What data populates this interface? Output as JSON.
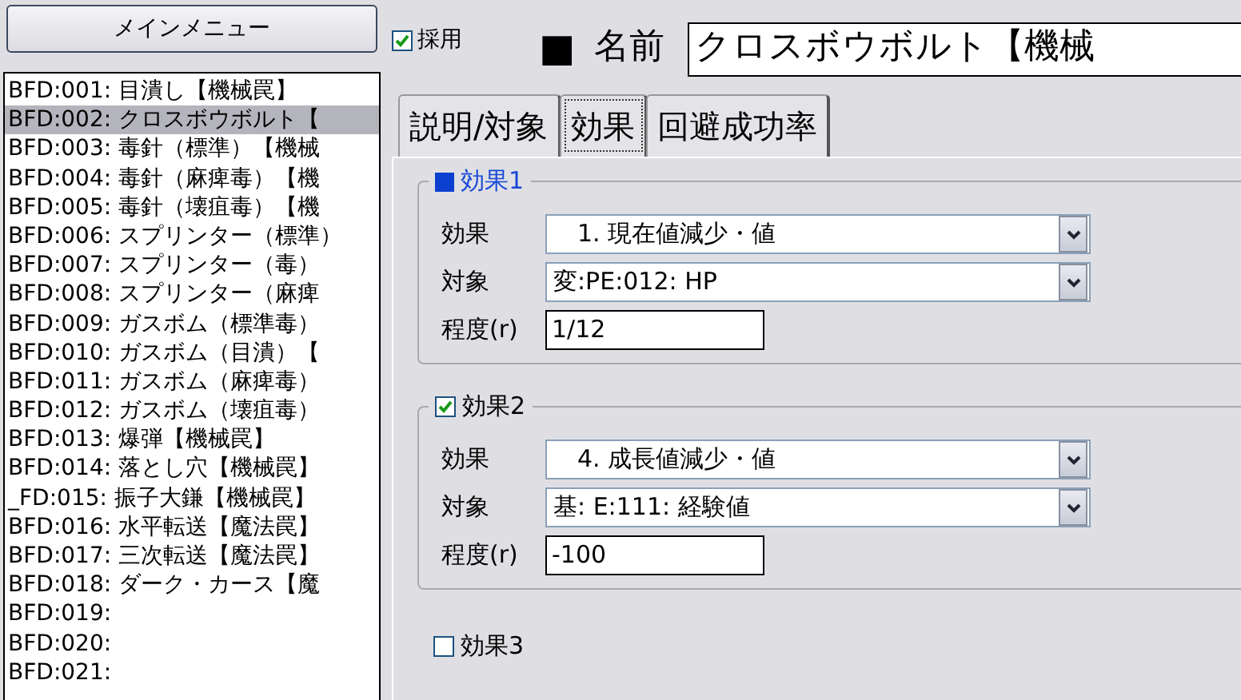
{
  "menu_button": "メインメニュー",
  "list_items": [
    {
      "label": "BFD:001: 目潰し【機械罠】",
      "selected": false
    },
    {
      "label": "BFD:002: クロスボウボルト【",
      "selected": true
    },
    {
      "label": "BFD:003: 毒針（標準）【機械",
      "selected": false
    },
    {
      "label": "BFD:004: 毒針（麻痺毒）【機",
      "selected": false
    },
    {
      "label": "BFD:005: 毒針（壊疽毒）【機",
      "selected": false
    },
    {
      "label": "BFD:006: スプリンター（標準）",
      "selected": false
    },
    {
      "label": "BFD:007: スプリンター（毒）",
      "selected": false
    },
    {
      "label": "BFD:008: スプリンター（麻痺",
      "selected": false
    },
    {
      "label": "BFD:009: ガスボム（標準毒）",
      "selected": false
    },
    {
      "label": "BFD:010: ガスボム（目潰）【",
      "selected": false
    },
    {
      "label": "BFD:011: ガスボム（麻痺毒）",
      "selected": false
    },
    {
      "label": "BFD:012: ガスボム（壊疽毒）",
      "selected": false
    },
    {
      "label": "BFD:013: 爆弾【機械罠】",
      "selected": false
    },
    {
      "label": "BFD:014: 落とし穴【機械罠】",
      "selected": false
    },
    {
      "label": "_FD:015: 振子大鎌【機械罠】",
      "selected": false
    },
    {
      "label": "BFD:016: 水平転送【魔法罠】",
      "selected": false
    },
    {
      "label": "BFD:017: 三次転送【魔法罠】",
      "selected": false
    },
    {
      "label": "BFD:018: ダーク・カース【魔",
      "selected": false
    },
    {
      "label": "BFD:019:",
      "selected": false
    },
    {
      "label": "BFD:020:",
      "selected": false
    },
    {
      "label": "BFD:021:",
      "selected": false
    }
  ],
  "adopt": {
    "label": "採用",
    "checked": true
  },
  "name": {
    "marker": "■",
    "label": "名前",
    "value": "クロスボウボルト【機械"
  },
  "tabs": [
    {
      "label": "説明/対象",
      "selected": false
    },
    {
      "label": "効果",
      "selected": true
    },
    {
      "label": "回避成功率",
      "selected": false
    }
  ],
  "effects": [
    {
      "kind": "marker",
      "title": "効果1",
      "fields": {
        "effect_label": "効果",
        "effect": "　1. 現在値減少・値",
        "target_label": "対象",
        "target": "変:PE:012: HP",
        "degree_label": "程度(r)",
        "degree": "1/12"
      }
    },
    {
      "kind": "checkbox",
      "checked": true,
      "title": "効果2",
      "fields": {
        "effect_label": "効果",
        "effect": "　4. 成長値減少・値",
        "target_label": "対象",
        "target": "基: E:111: 経験値",
        "degree_label": "程度(r)",
        "degree": "-100"
      }
    },
    {
      "kind": "checkbox",
      "checked": false,
      "title": "効果3"
    }
  ]
}
